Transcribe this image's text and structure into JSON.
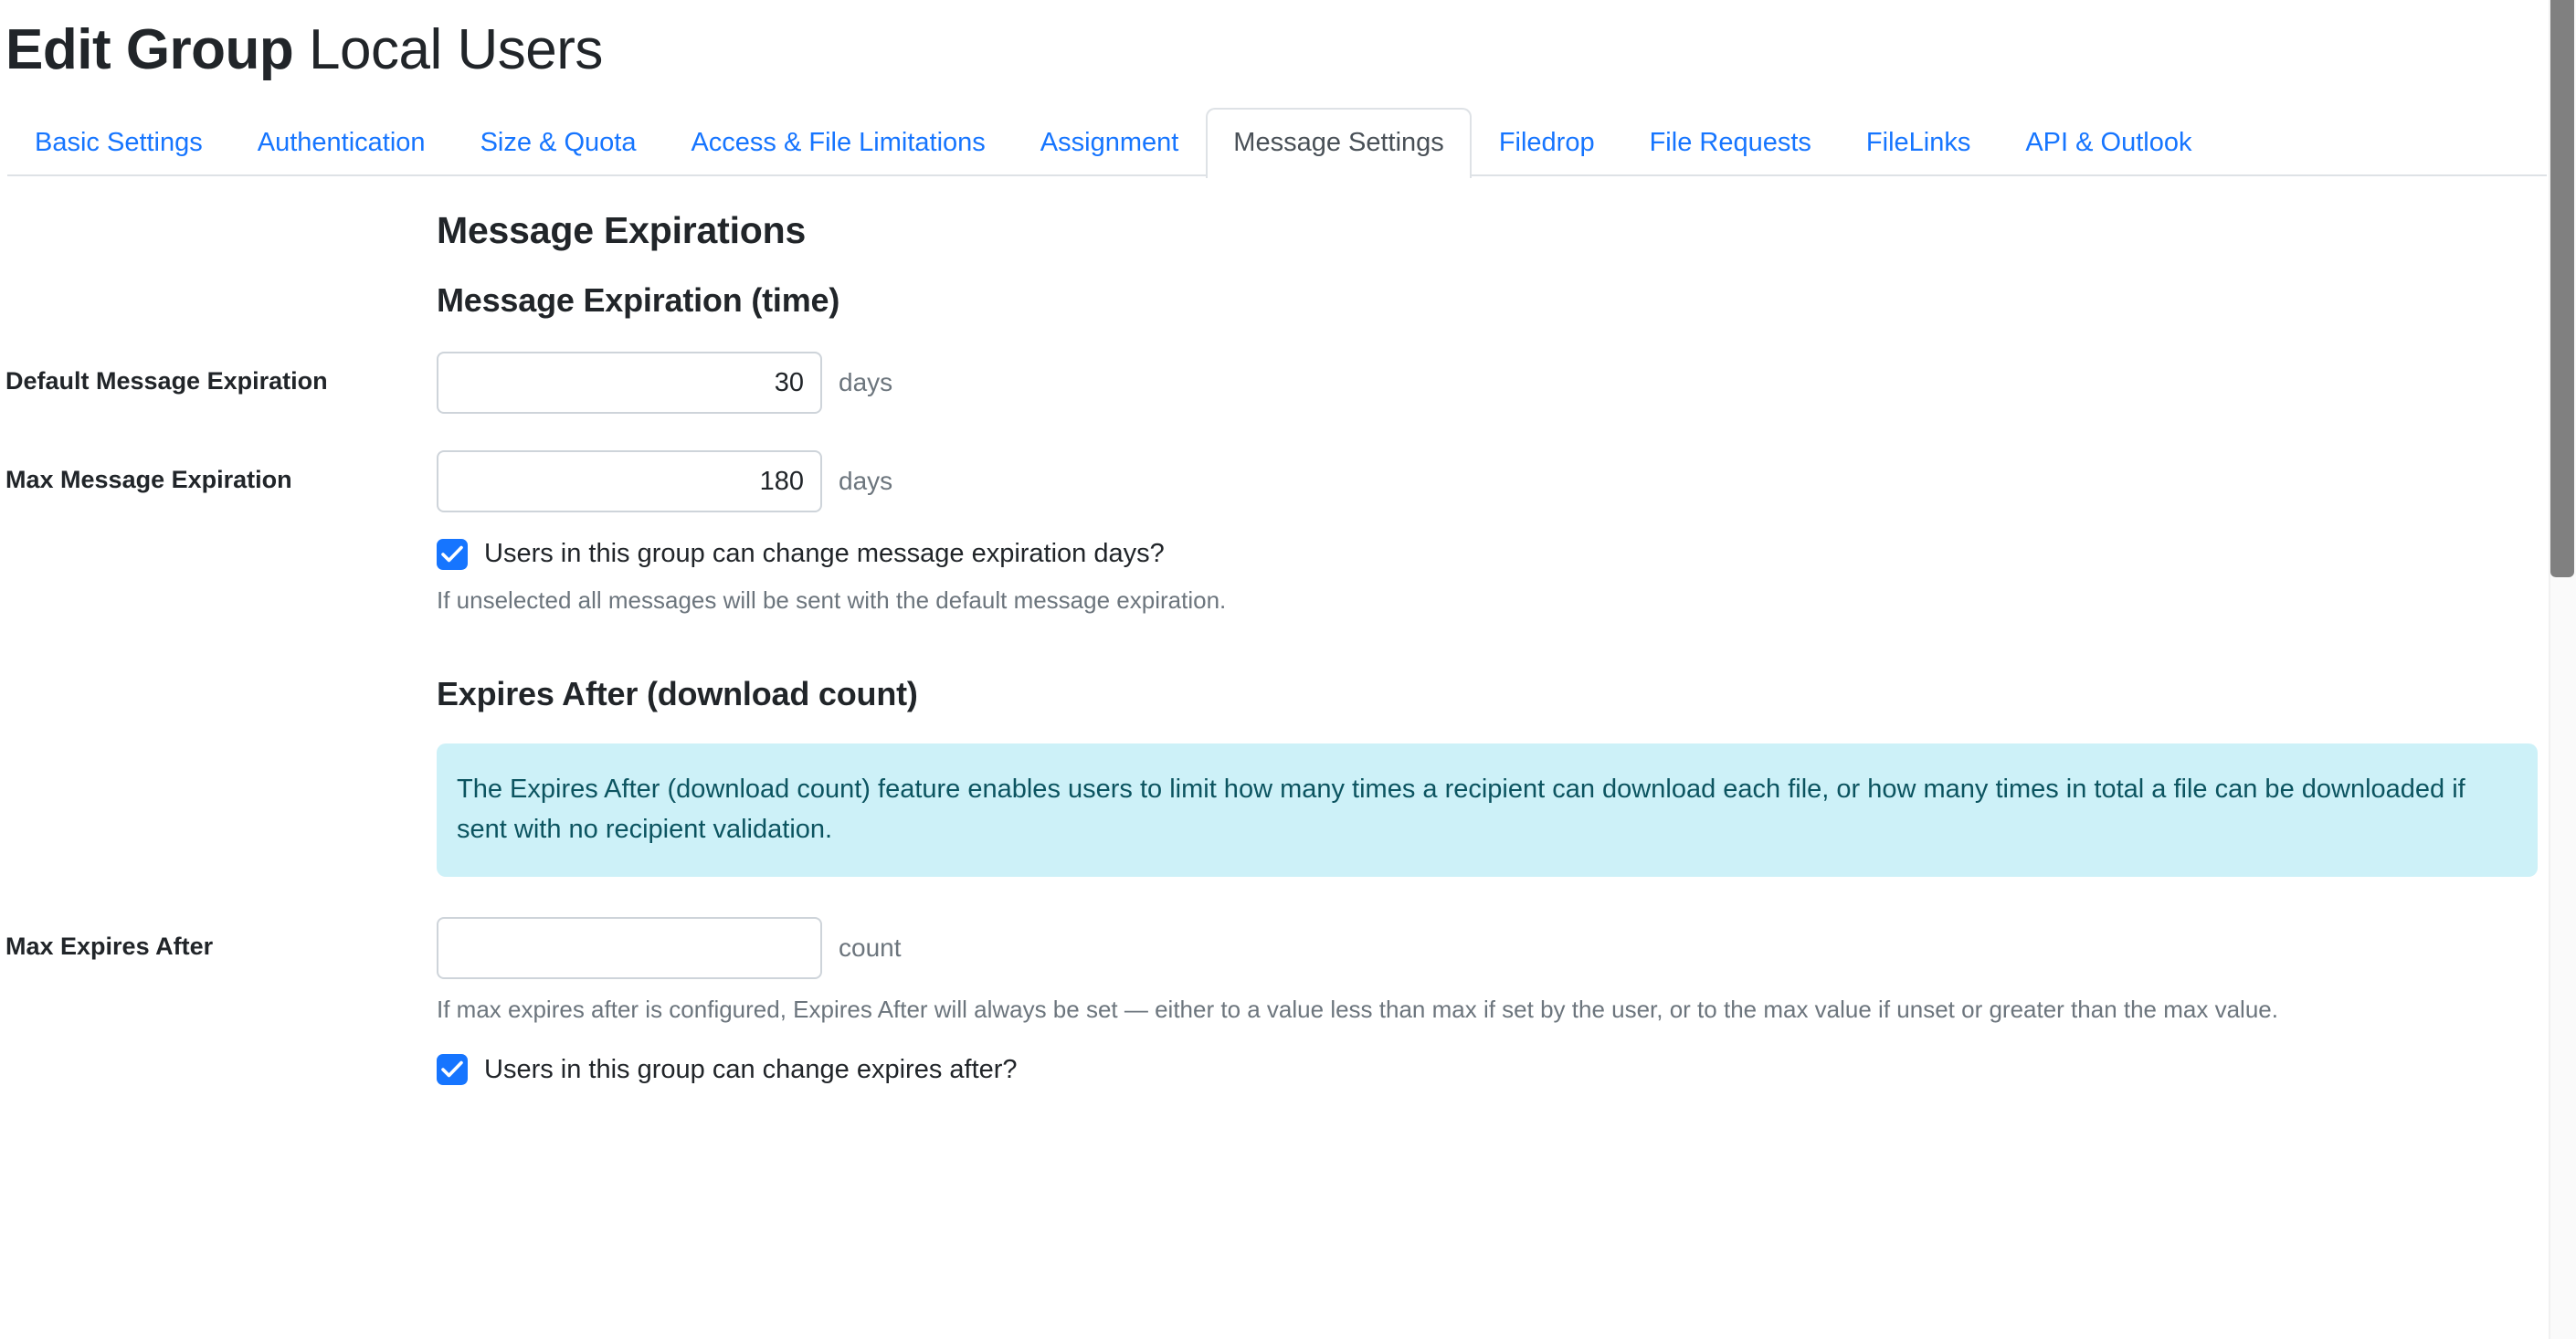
{
  "header": {
    "title_strong": "Edit Group",
    "title_light": "Local Users"
  },
  "tabs": [
    {
      "label": "Basic Settings",
      "active": false
    },
    {
      "label": "Authentication",
      "active": false
    },
    {
      "label": "Size & Quota",
      "active": false
    },
    {
      "label": "Access & File Limitations",
      "active": false
    },
    {
      "label": "Assignment",
      "active": false
    },
    {
      "label": "Message Settings",
      "active": true
    },
    {
      "label": "Filedrop",
      "active": false
    },
    {
      "label": "File Requests",
      "active": false
    },
    {
      "label": "FileLinks",
      "active": false
    },
    {
      "label": "API & Outlook",
      "active": false
    }
  ],
  "main": {
    "section_title": "Message Expirations",
    "expiration_time": {
      "subsection_title": "Message Expiration (time)",
      "default_expiration": {
        "label": "Default Message Expiration",
        "value": "30",
        "placeholder": "",
        "suffix": "days"
      },
      "max_expiration": {
        "label": "Max Message Expiration",
        "value": "180",
        "placeholder": "",
        "suffix": "days"
      },
      "allow_change": {
        "label": "Users in this group can change message expiration days?",
        "checked": true,
        "help": "If unselected all messages will be sent with the default message expiration."
      }
    },
    "expires_after": {
      "subsection_title": "Expires After (download count)",
      "info": "The Expires After (download count) feature enables users to limit how many times a recipient can download each file, or how many times in total a file can be downloaded if sent with no recipient validation.",
      "max_expires_after": {
        "label": "Max Expires After",
        "value": "",
        "placeholder": "",
        "suffix": "count",
        "help": "If max expires after is configured, Expires After will always be set — either to a value less than max if set by the user, or to the max value if unset or greater than the max value."
      },
      "allow_change": {
        "label": "Users in this group can change expires after?",
        "checked": true
      }
    }
  },
  "colors": {
    "link_blue": "#1675ff",
    "accent_checkbox": "#1675ff",
    "info_bg": "#cdf1f8",
    "info_text": "#0c5460",
    "border_gray": "#ced4da",
    "muted_text": "#6c757d"
  },
  "scrollbar": {
    "orientation": "vertical",
    "thumb_position": "top"
  }
}
